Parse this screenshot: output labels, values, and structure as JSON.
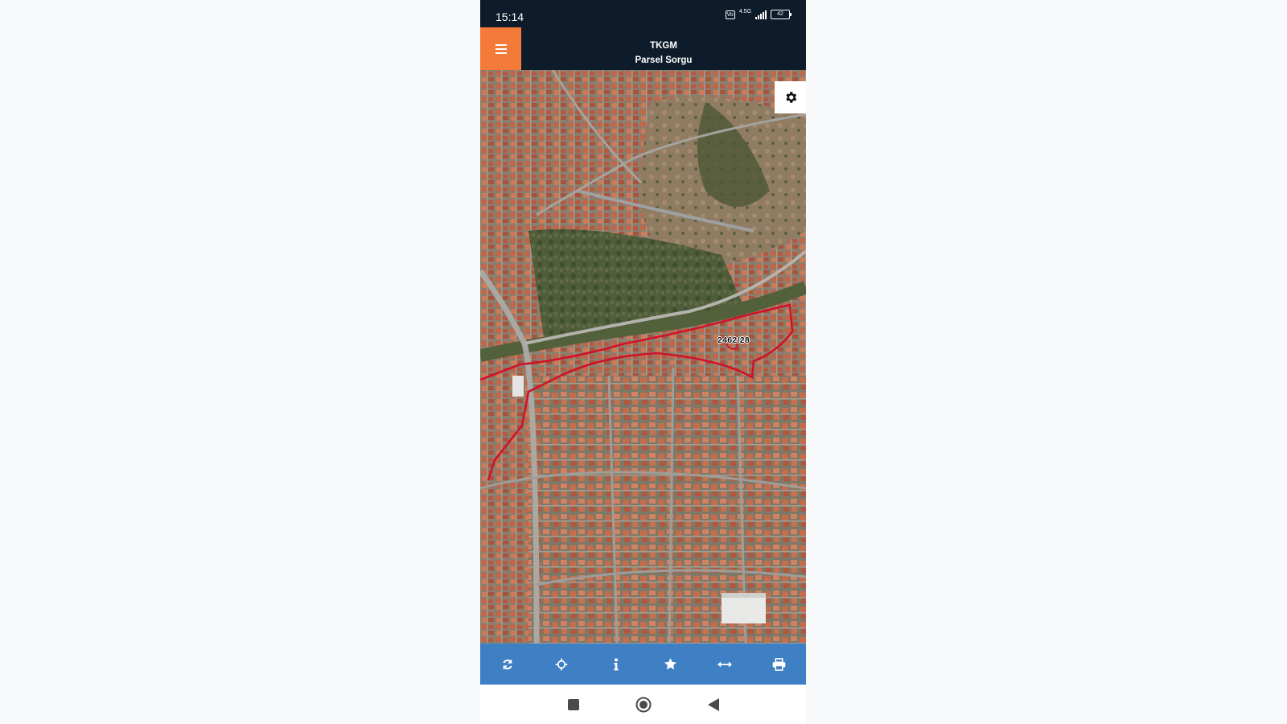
{
  "status_bar": {
    "time": "15:14",
    "volte_badge": "Vo",
    "network_type": "4.5G",
    "battery_level": "42"
  },
  "header": {
    "title": "TKGM",
    "subtitle": "Parsel Sorgu",
    "menu_icon": "hamburger-menu-icon",
    "accent_color": "#f47a3a",
    "background_color": "#0d1b2a"
  },
  "map": {
    "view": "satellite",
    "parcel_label": "2462/28",
    "parcel_outline_color": "#d0122a",
    "settings_icon": "gear-icon"
  },
  "toolbar": {
    "background_color": "#3f7fc4",
    "buttons": [
      {
        "icon": "refresh-icon"
      },
      {
        "icon": "crosshair-locate-icon"
      },
      {
        "icon": "info-icon"
      },
      {
        "icon": "star-icon"
      },
      {
        "icon": "measure-arrows-icon"
      },
      {
        "icon": "print-icon"
      }
    ]
  },
  "nav_bar": {
    "buttons": [
      {
        "icon": "recent-apps-square-icon"
      },
      {
        "icon": "home-circle-icon"
      },
      {
        "icon": "back-triangle-icon"
      }
    ]
  }
}
